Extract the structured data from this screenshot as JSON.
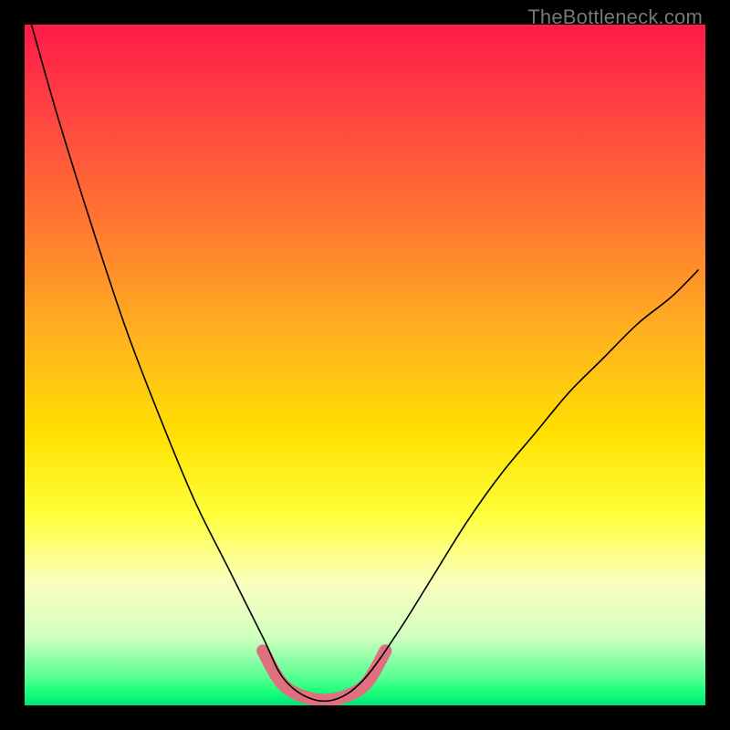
{
  "watermark": "TheBottleneck.com",
  "colors": {
    "frame": "#000000",
    "gradient_top": "#ff1a4a",
    "gradient_bottom": "#00e67a",
    "curve": "#000000",
    "highlight": "#e07080",
    "watermark_text": "#777777"
  },
  "chart_data": {
    "type": "line",
    "title": "",
    "xlabel": "",
    "ylabel": "",
    "xlim": [
      0,
      100
    ],
    "ylim": [
      0,
      100
    ],
    "grid": false,
    "legend": false,
    "notes": "Image is a bottleneck-style curve over a vertical red-to-green gradient. No axis ticks or numeric labels are shown; x/y are normalized 0-100 from visual estimate. Left branch falls steeply from top-left to a flat trough ~x38-50 at bottom, right branch rises with decreasing slope toward upper right. Pink highlight traces the trough region.",
    "series": [
      {
        "name": "curve",
        "x": [
          1,
          5,
          10,
          15,
          20,
          25,
          30,
          35,
          38,
          42,
          46,
          50,
          55,
          60,
          65,
          70,
          75,
          80,
          85,
          90,
          95,
          99
        ],
        "y": [
          100,
          86,
          70,
          55,
          42,
          30,
          20,
          10,
          4,
          1,
          1,
          4,
          11,
          19,
          27,
          34,
          40,
          46,
          51,
          56,
          60,
          64
        ]
      },
      {
        "name": "highlight_trough",
        "x": [
          35,
          38,
          42,
          46,
          50,
          53
        ],
        "y": [
          8,
          3,
          1,
          1,
          3,
          8
        ]
      }
    ]
  }
}
